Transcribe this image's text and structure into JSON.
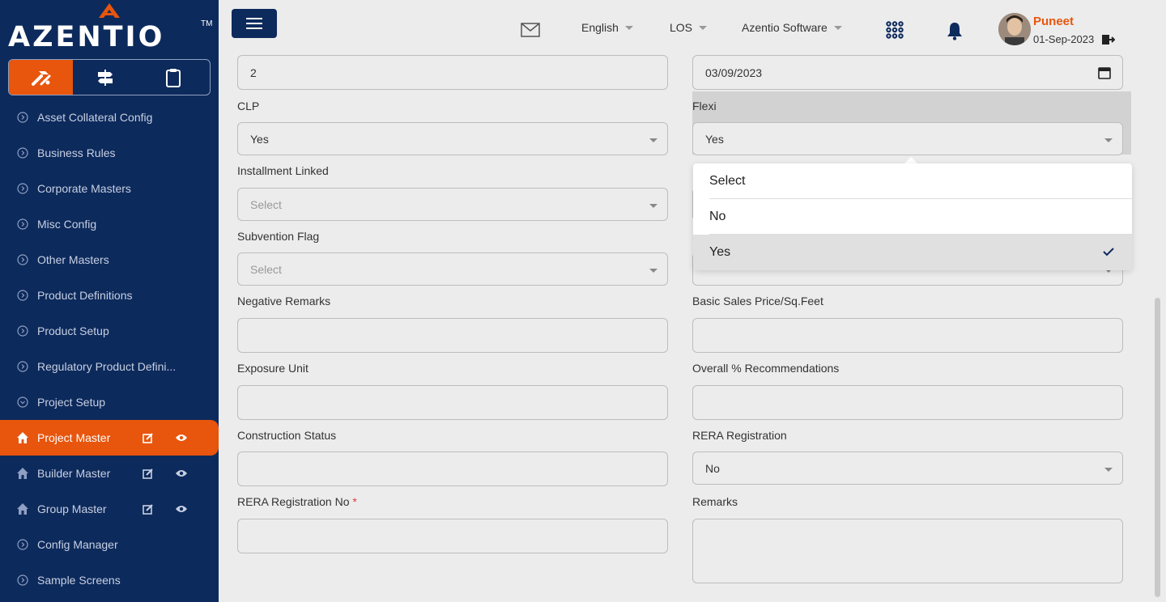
{
  "brand": {
    "name": "AZENTIO",
    "tm": "TM"
  },
  "sidebar": {
    "items": [
      {
        "label": "Asset Collateral Config"
      },
      {
        "label": "Business Rules"
      },
      {
        "label": "Corporate Masters"
      },
      {
        "label": "Misc Config"
      },
      {
        "label": "Other Masters"
      },
      {
        "label": "Product Definitions"
      },
      {
        "label": "Product Setup"
      },
      {
        "label": "Regulatory Product Defini..."
      },
      {
        "label": "Project Setup"
      },
      {
        "label": "Project Master"
      },
      {
        "label": "Builder Master"
      },
      {
        "label": "Group Master"
      },
      {
        "label": "Config Manager"
      },
      {
        "label": "Sample Screens"
      }
    ]
  },
  "header": {
    "language": "English",
    "module": "LOS",
    "org": "Azentio Software",
    "user_name": "Puneet",
    "user_date": "01-Sep-2023"
  },
  "form": {
    "top_left_value": "2",
    "top_right_value": "03/09/2023",
    "clp_label": "CLP",
    "clp_value": "Yes",
    "flexi_label": "Flexi",
    "flexi_value": "Yes",
    "installment_linked_label": "Installment Linked",
    "installment_linked_placeholder": "Select",
    "subvention_flag_label": "Subvention Flag",
    "subvention_flag_placeholder": "Select",
    "negative_remarks_label": "Negative Remarks",
    "basic_sales_price_label": "Basic Sales Price/Sq.Feet",
    "exposure_unit_label": "Exposure Unit",
    "overall_recommendations_label": "Overall % Recommendations",
    "construction_status_label": "Construction Status",
    "rera_registration_label": "RERA Registration",
    "rera_registration_value": "No",
    "rera_registration_no_label": "RERA Registration No",
    "required_mark": "*",
    "remarks_label": "Remarks"
  },
  "dropdown": {
    "options": [
      {
        "label": "Select"
      },
      {
        "label": "No"
      },
      {
        "label": "Yes"
      }
    ]
  },
  "colors": {
    "navy": "#0d2a5c",
    "accent": "#e8550d"
  }
}
